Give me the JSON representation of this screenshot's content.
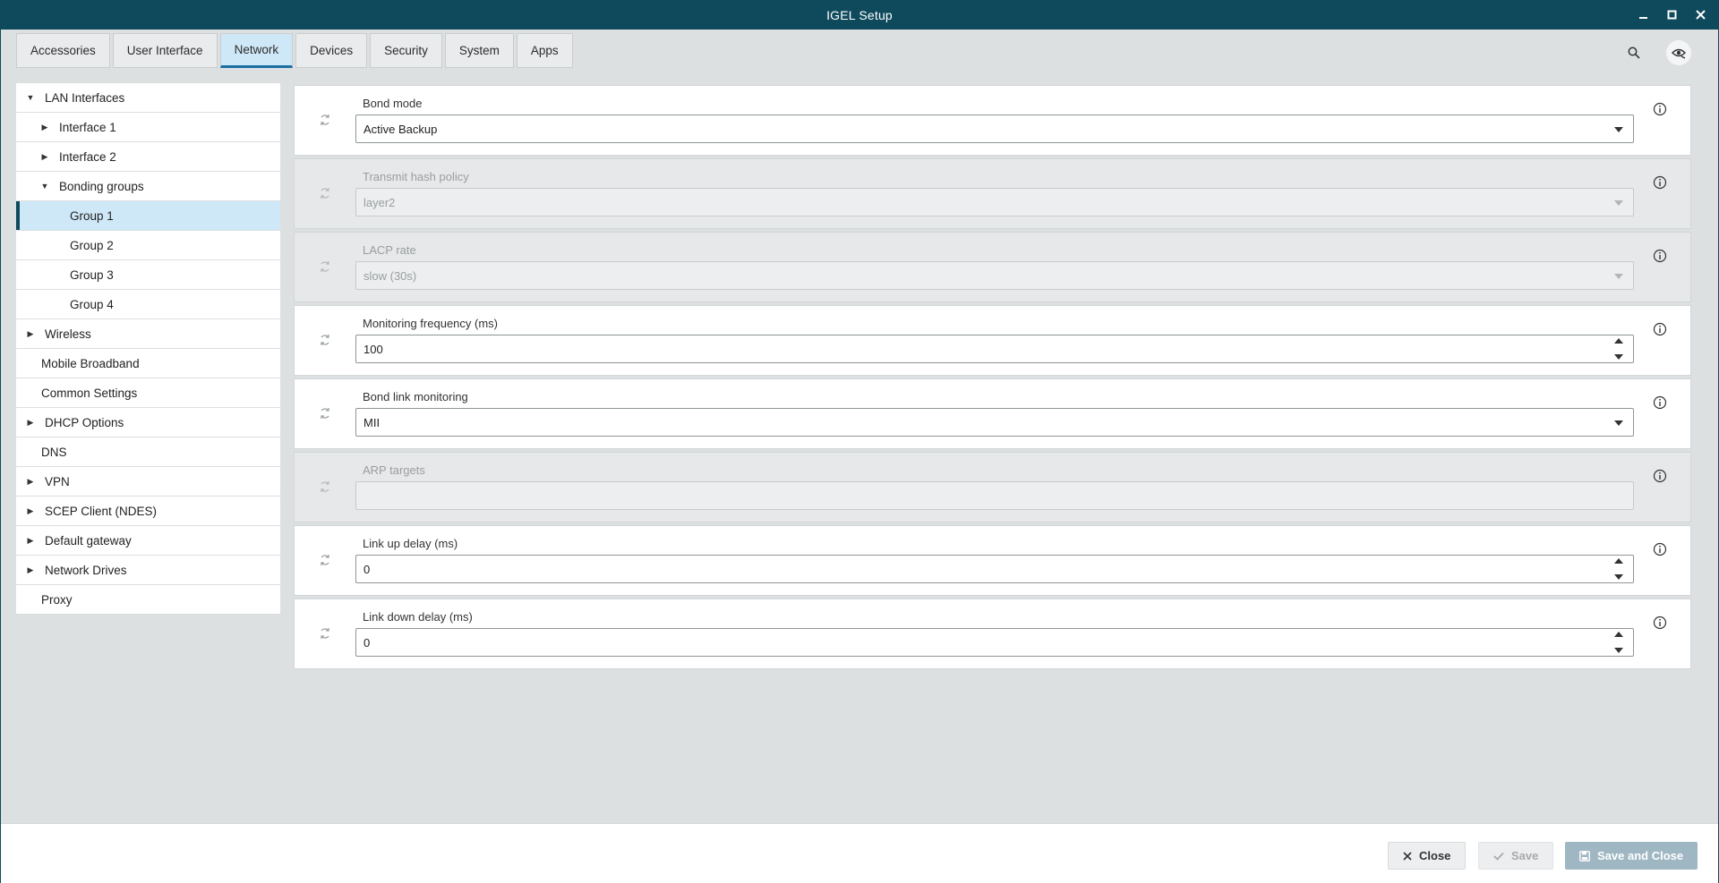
{
  "window": {
    "title": "IGEL Setup"
  },
  "tabs": [
    {
      "label": "Accessories",
      "active": false
    },
    {
      "label": "User Interface",
      "active": false
    },
    {
      "label": "Network",
      "active": true
    },
    {
      "label": "Devices",
      "active": false
    },
    {
      "label": "Security",
      "active": false
    },
    {
      "label": "System",
      "active": false
    },
    {
      "label": "Apps",
      "active": false
    }
  ],
  "top_icons": [
    "search-icon",
    "hide-eye-icon"
  ],
  "sidebar": {
    "items": [
      {
        "label": "LAN Interfaces",
        "level": 0,
        "arrow": "expanded"
      },
      {
        "label": "Interface 1",
        "level": 1,
        "arrow": "collapsed"
      },
      {
        "label": "Interface 2",
        "level": 1,
        "arrow": "collapsed"
      },
      {
        "label": "Bonding groups",
        "level": 1,
        "arrow": "expanded"
      },
      {
        "label": "Group 1",
        "level": 2,
        "selected": true
      },
      {
        "label": "Group 2",
        "level": 2
      },
      {
        "label": "Group 3",
        "level": 2
      },
      {
        "label": "Group 4",
        "level": 2
      },
      {
        "label": "Wireless",
        "level": 0,
        "arrow": "collapsed"
      },
      {
        "label": "Mobile Broadband",
        "level": 0
      },
      {
        "label": "Common Settings",
        "level": 0
      },
      {
        "label": "DHCP Options",
        "level": 0,
        "arrow": "collapsed"
      },
      {
        "label": "DNS",
        "level": 0
      },
      {
        "label": "VPN",
        "level": 0,
        "arrow": "collapsed"
      },
      {
        "label": "SCEP Client (NDES)",
        "level": 0,
        "arrow": "collapsed"
      },
      {
        "label": "Default gateway",
        "level": 0,
        "arrow": "collapsed"
      },
      {
        "label": "Network Drives",
        "level": 0,
        "arrow": "collapsed"
      },
      {
        "label": "Proxy",
        "level": 0
      }
    ]
  },
  "settings": {
    "bond_mode": {
      "label": "Bond mode",
      "value": "Active Backup"
    },
    "transmit_hash_policy": {
      "label": "Transmit hash policy",
      "value": "layer2"
    },
    "lacp_rate": {
      "label": "LACP rate",
      "value": "slow (30s)"
    },
    "monitoring_frequency": {
      "label": "Monitoring frequency (ms)",
      "value": "100"
    },
    "bond_link_monitoring": {
      "label": "Bond link monitoring",
      "value": "MII"
    },
    "arp_targets": {
      "label": "ARP targets",
      "value": ""
    },
    "link_up_delay": {
      "label": "Link up delay (ms)",
      "value": "0"
    },
    "link_down_delay": {
      "label": "Link down delay (ms)",
      "value": "0"
    }
  },
  "footer": {
    "close_label": "Close",
    "save_label": "Save",
    "save_close_label": "Save and Close"
  },
  "colors": {
    "titlebar": "#0e4a5c",
    "selected_bg": "#cfe8f7",
    "accent": "#1b6fa3"
  }
}
